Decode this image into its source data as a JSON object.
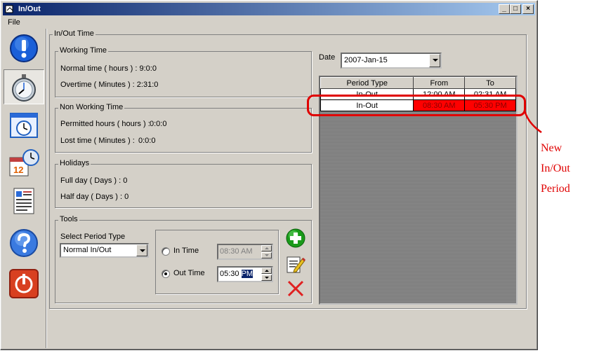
{
  "window": {
    "title": "In/Out",
    "minimize_label": "_",
    "maximize_label": "□",
    "close_label": "×"
  },
  "menu": {
    "file": "File"
  },
  "sidebar": {
    "items": [
      {
        "name": "alert",
        "icon": "exclamation-icon"
      },
      {
        "name": "stopwatch",
        "icon": "stopwatch-icon"
      },
      {
        "name": "clock-window",
        "icon": "clock-window-icon"
      },
      {
        "name": "calendar",
        "icon": "calendar-clock-icon",
        "badge": "12"
      },
      {
        "name": "report",
        "icon": "report-icon"
      },
      {
        "name": "help",
        "icon": "help-icon"
      },
      {
        "name": "exit",
        "icon": "power-icon"
      }
    ]
  },
  "main": {
    "group_title": "In/Out Time",
    "working_time": {
      "title": "Working Time",
      "normal": "Normal time ( hours ) :  9:0:0",
      "overtime": "Overtime ( Minutes ) :  2:31:0"
    },
    "non_working_time": {
      "title": "Non Working Time",
      "permitted_label": "Permitted hours ( hours ) :",
      "permitted_value": "0:0:0",
      "lost_label": "Lost time ( Minutes ) :",
      "lost_value": "0:0:0"
    },
    "holidays": {
      "title": "Holidays",
      "full_day": "Full day ( Days ) :   0",
      "half_day": "Half day ( Days ) :   0"
    },
    "tools": {
      "title": "Tools",
      "select_label": "Select Period Type",
      "period_type_value": "Normal In/Out",
      "in_time_label": "In Time",
      "in_time_value": "08:30 AM",
      "out_time_label": "Out Time",
      "out_time_prefix": "05:30 ",
      "out_time_selected": "PM",
      "add_icon": "add-icon",
      "edit_icon": "edit-icon",
      "delete_icon": "delete-icon"
    },
    "date": {
      "label": "Date",
      "value": "2007-Jan-15"
    },
    "periods": {
      "columns": [
        "Period Type",
        "From",
        "To"
      ],
      "rows": [
        {
          "type": "In-Out",
          "from": "12:00 AM",
          "to": "02:31 AM"
        },
        {
          "type": "In-Out",
          "from": "08:30 AM",
          "to": "05:30 PM"
        }
      ]
    }
  },
  "annotation": {
    "line1": "New",
    "line2": "In/Out",
    "line3": "Period",
    "color": "#e00000"
  }
}
